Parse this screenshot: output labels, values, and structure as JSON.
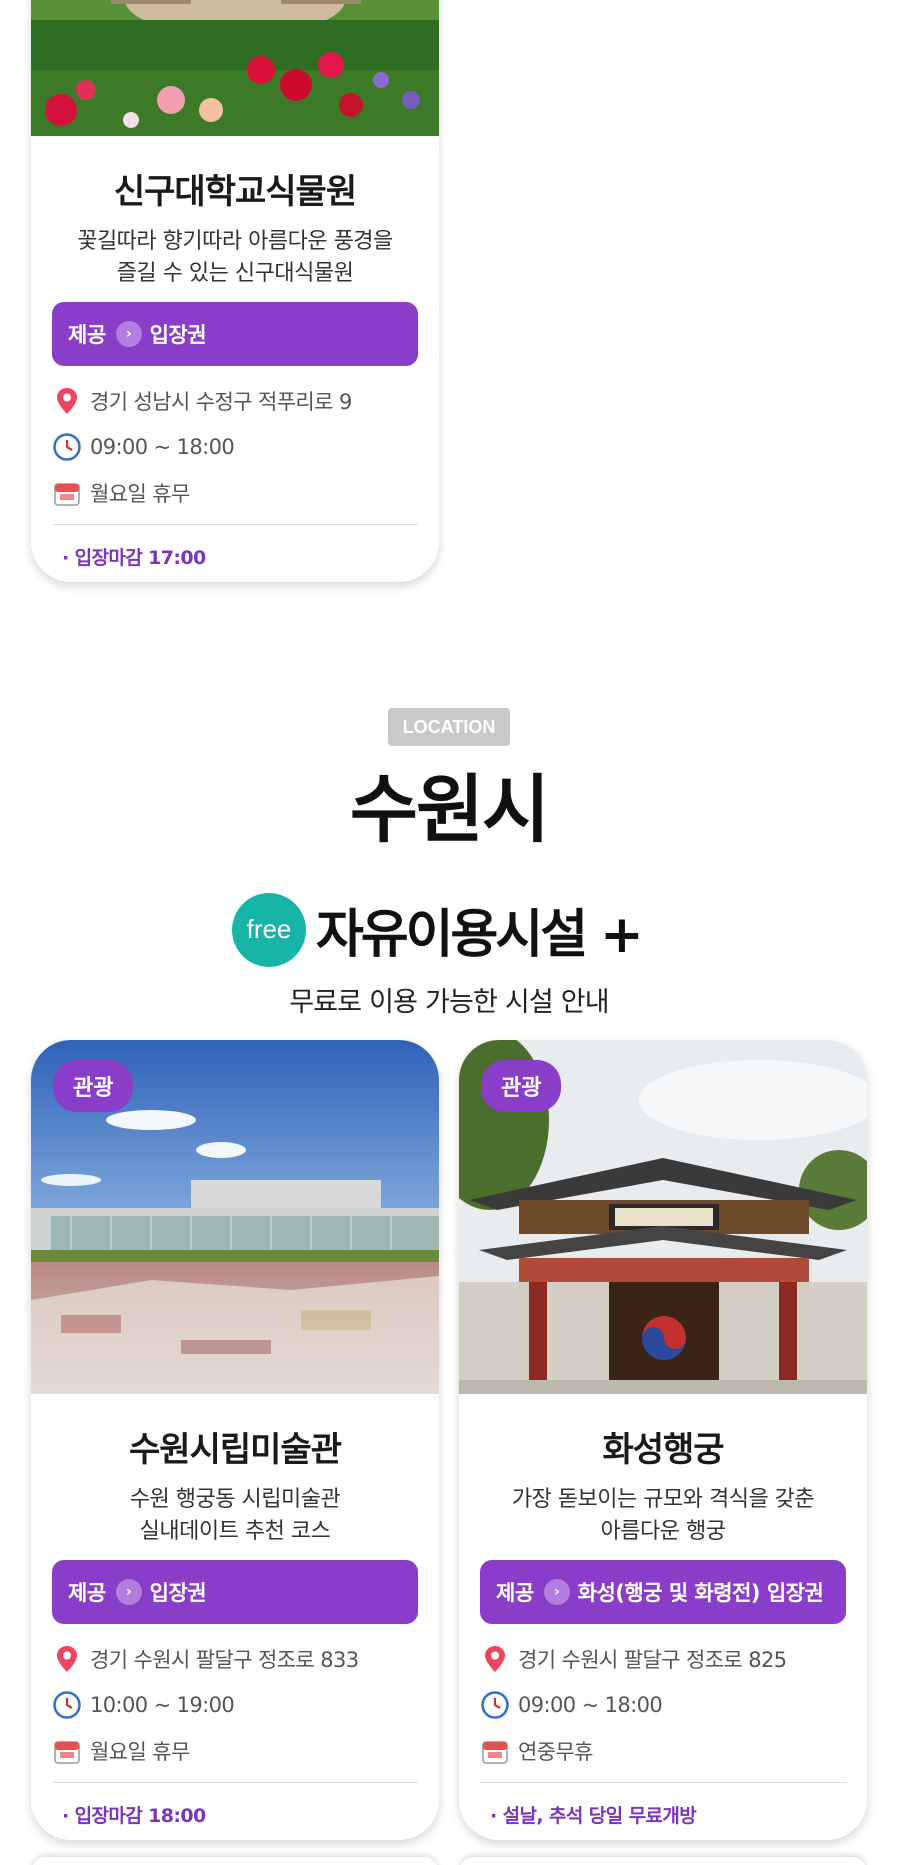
{
  "cards_top": [
    {
      "title": "신구대학교식물원",
      "desc_line1": "꽃길따라 향기따라 아름다운 풍경을",
      "desc_line2": "즐길 수 있는 신구대식물원",
      "provide_label": "제공",
      "provide_value": "입장권",
      "address": "경기 성남시 수정구 적푸리로 9",
      "hours": "09:00 ~ 18:00",
      "closed": "월요일 휴무",
      "note": "· 입장마감 17:00"
    }
  ],
  "section": {
    "badge": "LOCATION",
    "city": "수원시",
    "free_badge": "free",
    "free_title": "자유이용시설 +",
    "subtitle": "무료로 이용 가능한 시설 안내"
  },
  "cards": [
    {
      "tag": "관광",
      "title": "수원시립미술관",
      "desc_line1": "수원 행궁동 시립미술관",
      "desc_line2": "실내데이트 추천 코스",
      "provide_label": "제공",
      "provide_value": "입장권",
      "address": "경기 수원시 팔달구 정조로 833",
      "hours": "10:00 ~ 19:00",
      "closed": "월요일 휴무",
      "note": "· 입장마감 18:00"
    },
    {
      "tag": "관광",
      "title": "화성행궁",
      "desc_line1": "가장 돋보이는 규모와 격식을 갖춘",
      "desc_line2": "아름다운 행궁",
      "provide_label": "제공",
      "provide_value": "화성(행궁 및 화령전) 입장권",
      "address": "경기 수원시 팔달구 정조로 825",
      "hours": "09:00 ~ 18:00",
      "closed": "연중무휴",
      "note": "· 설날, 추석 당일 무료개방"
    }
  ],
  "icons": {
    "location": "map-pin-icon",
    "time": "clock-icon",
    "calendar": "calendar-icon",
    "arrow": "chevron-right-icon"
  },
  "colors": {
    "accent": "#8a3dc8",
    "free": "#17b5a8",
    "badge_gray": "#c9c9c9"
  }
}
